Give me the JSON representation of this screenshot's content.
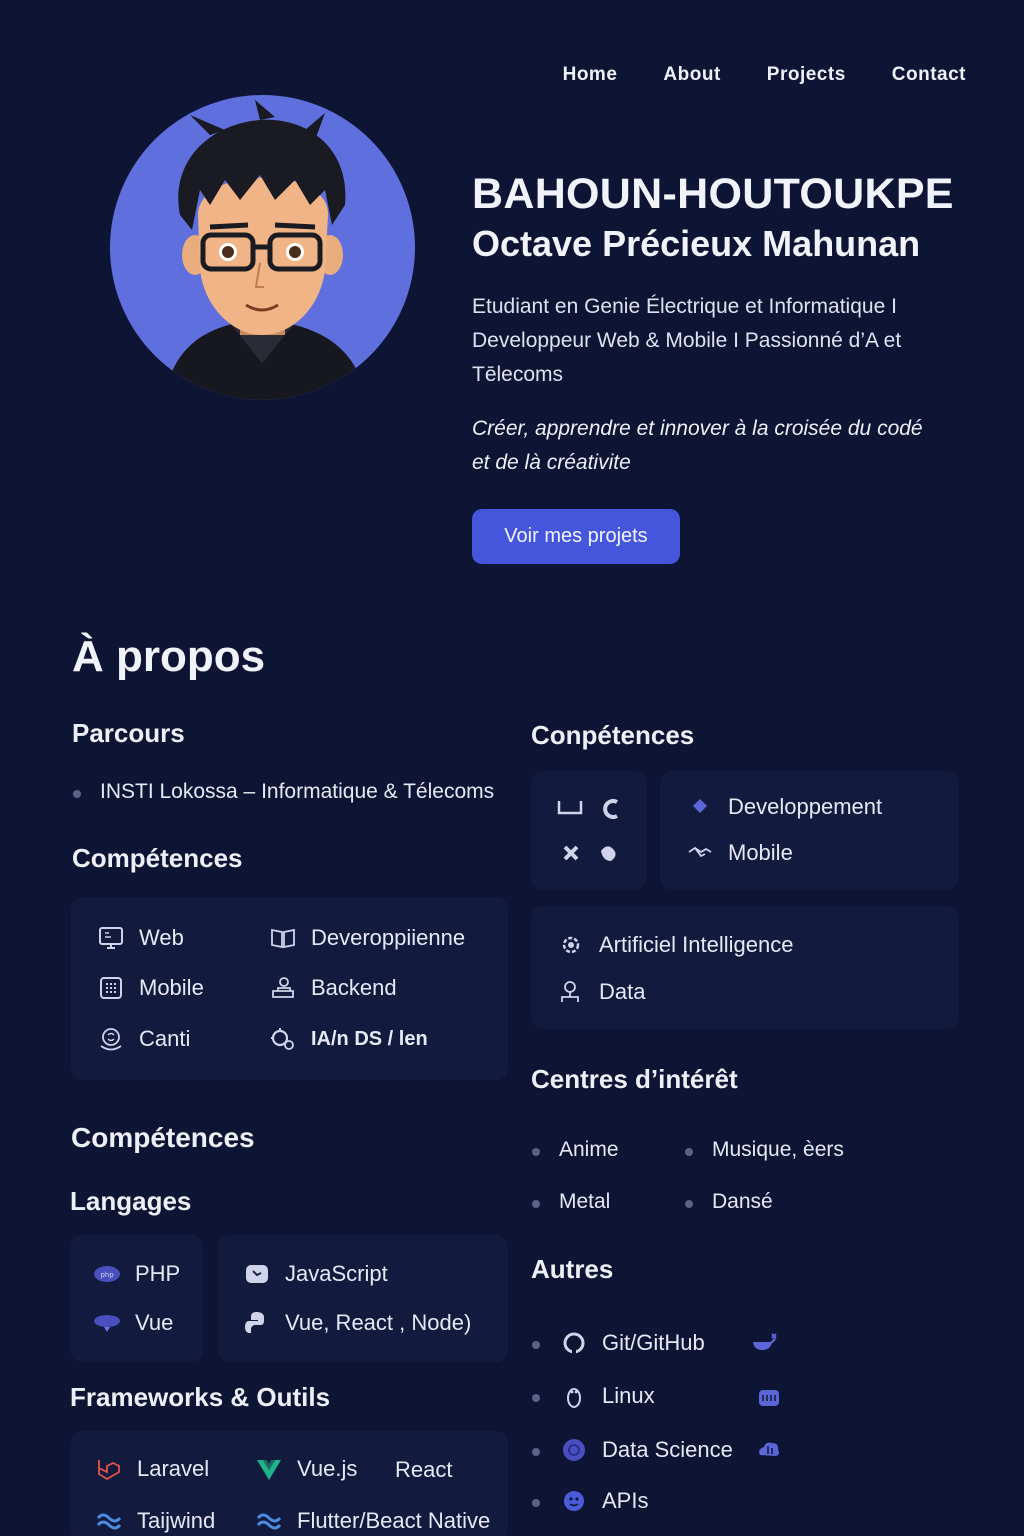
{
  "nav": [
    "Home",
    "About",
    "Projects",
    "Contact"
  ],
  "hero": {
    "name_line1": "BAHOUN-HOUTOUKPE",
    "name_line2": "Octave Précieux Mahunan",
    "tagline": "Etudiant en Genie Électrique et Informatique I Developpeur Web & Mobile I Passionné d’A et Tēlecoms",
    "motto": "Créer, apprendre et innover à la croisée du codé et de là créativite",
    "cta_label": "Voir mes projets"
  },
  "about": {
    "title": "À propos",
    "parcours": {
      "title": "Parcours",
      "items": [
        "INSTI Lokossa – Informatique & Télecoms"
      ]
    },
    "competences_left": {
      "title": "Compétences",
      "items": [
        {
          "label": "Web",
          "icon": "monitor-icon"
        },
        {
          "label": "Deveroppiienne",
          "icon": "book-icon"
        },
        {
          "label": "Mobile",
          "icon": "grid-icon"
        },
        {
          "label": "Backend",
          "icon": "user-desk-icon"
        },
        {
          "label": "Canti",
          "icon": "brain-icon"
        },
        {
          "label": "IA/n DS / len",
          "icon": "gears-icon"
        }
      ]
    },
    "competences_right": {
      "title": "Conpétences",
      "box_a": [
        {
          "label": "Developpement",
          "icon": "diamond-icon"
        },
        {
          "label": "Mobile",
          "icon": "handshake-icon"
        }
      ],
      "box_b": [
        {
          "label": "Artificiel Intelligence",
          "icon": "ai-gear-icon"
        },
        {
          "label": "Data",
          "icon": "person-data-icon"
        }
      ]
    },
    "interests": {
      "title": "Centres d’intérêt",
      "items": [
        "Anime",
        "Musique, èers",
        "Metal",
        "Dansé"
      ]
    },
    "competences_2": {
      "title": "Compétences",
      "langages_title": "Langages",
      "langages": [
        {
          "label": "PHP",
          "icon": "php-icon"
        },
        {
          "label": "JavaScript",
          "icon": "js-icon"
        },
        {
          "label": "Vue",
          "icon": "vue-cloud-icon"
        },
        {
          "label": "Vue, React , Node)",
          "icon": "python-icon"
        }
      ],
      "frameworks_title": "Frameworks & Outils",
      "frameworks": [
        {
          "label": "Laravel",
          "icon": "laravel-icon"
        },
        {
          "label": "Vue.js",
          "icon": "vuejs-icon"
        },
        {
          "label": "React",
          "icon": ""
        },
        {
          "label": "Taijwind",
          "icon": "tailwind-icon"
        },
        {
          "label": "Flutter/Beact Native",
          "icon": "tailwind-icon"
        }
      ]
    },
    "autres": {
      "title": "Autres",
      "items": [
        {
          "label": "Git/GitHub",
          "icon": "github-icon",
          "extra": "docker-icon"
        },
        {
          "label": "Linux",
          "icon": "linux-icon",
          "extra": "server-icon"
        },
        {
          "label": "Data Science",
          "icon": "data-science-icon",
          "extra": "cloud-db-icon"
        },
        {
          "label": "APIs",
          "icon": "api-icon"
        }
      ]
    }
  },
  "colors": {
    "background": "#0e1433",
    "card": "#121a3e",
    "accent": "#4555dc",
    "avatar_bg": "#5f6fde"
  }
}
